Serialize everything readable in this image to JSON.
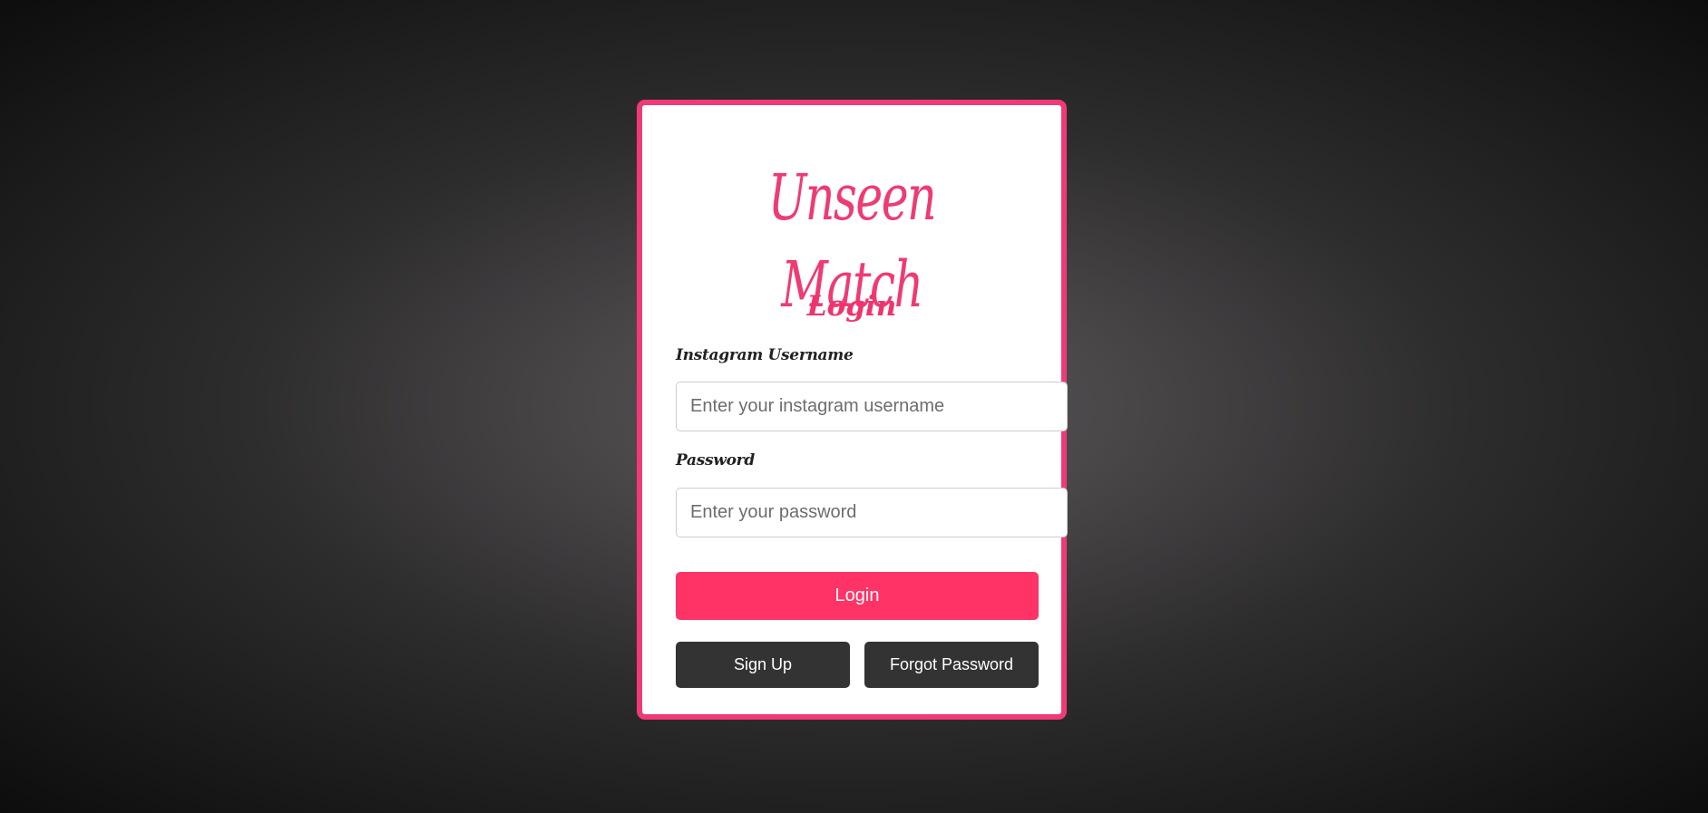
{
  "app": {
    "logo_text": "Unseen Match",
    "heading": "Login"
  },
  "form": {
    "username": {
      "label": "Instagram Username",
      "placeholder": "Enter your instagram username",
      "value": ""
    },
    "password": {
      "label": "Password",
      "placeholder": "Enter your password",
      "value": ""
    }
  },
  "actions": {
    "login_label": "Login",
    "signup_label": "Sign Up",
    "forgot_label": "Forgot Password"
  },
  "colors": {
    "accent": "#ff3366",
    "border": "#ef3a76",
    "secondary_button": "#333333"
  }
}
